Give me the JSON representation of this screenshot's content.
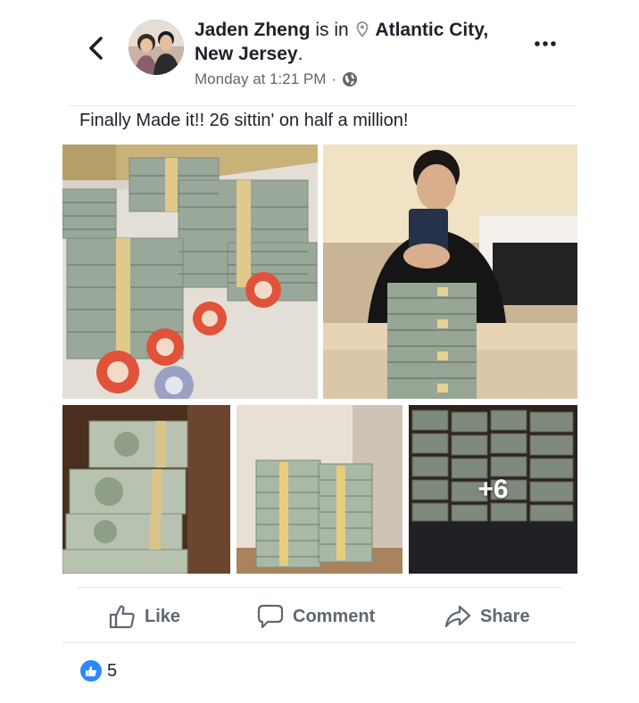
{
  "post": {
    "author": "Jaden Zheng",
    "is_in_text": "is in",
    "location": "Atlantic City,",
    "location_line2": "New Jersey",
    "location_end": ".",
    "timestamp": "Monday at 1:21 PM",
    "meta_separator": "·",
    "privacy_icon": "globe-icon",
    "text": "Finally Made it!! 26 sittin' on half a million!"
  },
  "photos": {
    "more_count": "+6"
  },
  "actions": {
    "like_label": "Like",
    "comment_label": "Comment",
    "share_label": "Share"
  },
  "reactions": {
    "count": "5",
    "icon": "thumbs-up-icon"
  },
  "colors": {
    "text_primary": "#1d2129",
    "text_secondary": "#606770",
    "accent_blue": "#2d88ff",
    "divider": "#e4e6eb"
  }
}
